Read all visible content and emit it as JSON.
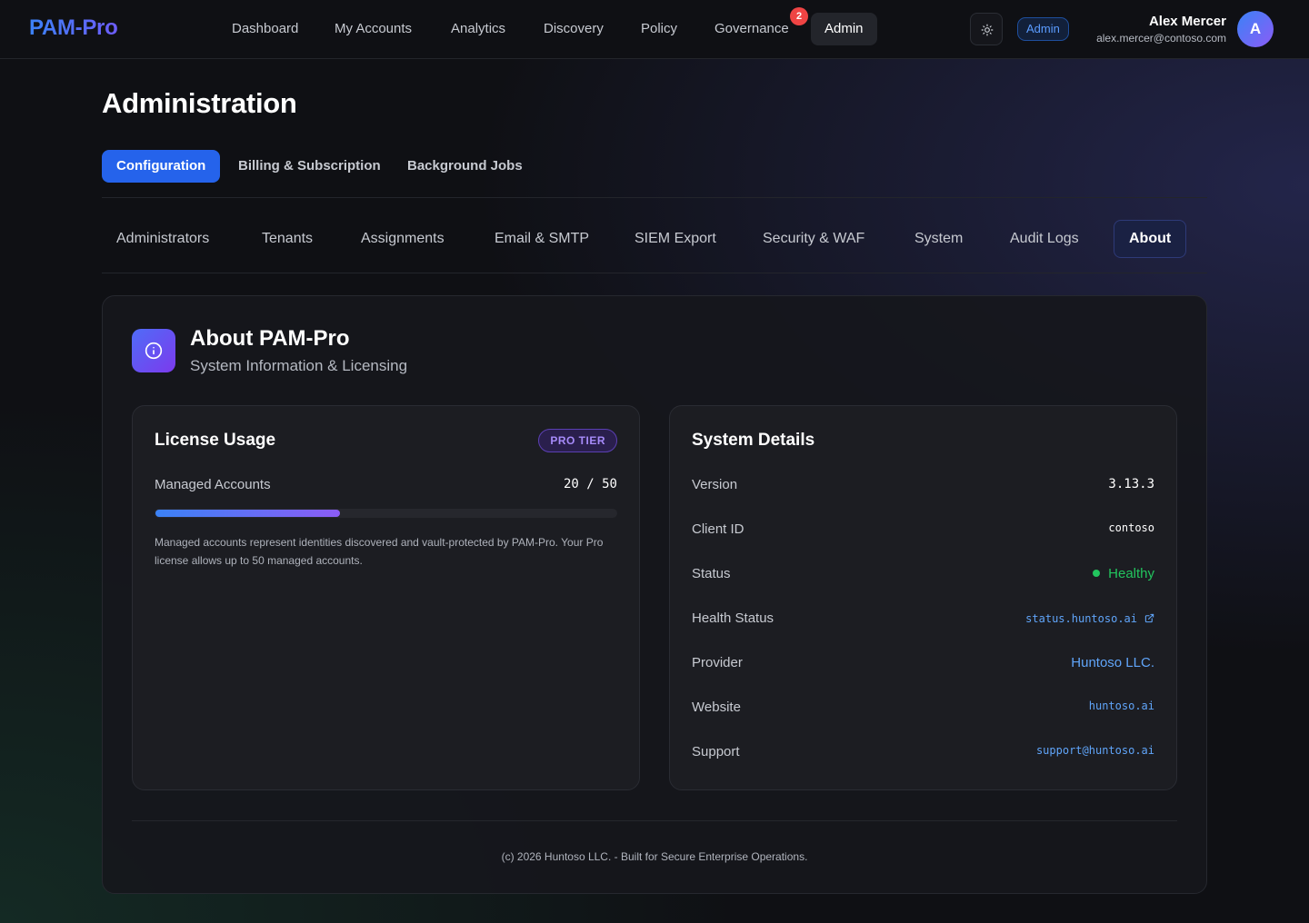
{
  "app": {
    "brand": "PAM-Pro"
  },
  "nav": {
    "items": [
      {
        "label": "Dashboard"
      },
      {
        "label": "My Accounts"
      },
      {
        "label": "Analytics"
      },
      {
        "label": "Discovery"
      },
      {
        "label": "Policy"
      },
      {
        "label": "Governance"
      },
      {
        "label": "Admin"
      }
    ],
    "active": "Admin",
    "governance_badge": "2"
  },
  "header": {
    "theme_icon": "sun-icon",
    "role_badge": "Admin",
    "user": {
      "name": "Alex Mercer",
      "email": "alex.mercer@contoso.com",
      "avatar_initial": "A"
    }
  },
  "page": {
    "title": "Administration"
  },
  "primary_tabs": [
    {
      "label": "Configuration"
    },
    {
      "label": "Billing & Subscription"
    },
    {
      "label": "Background Jobs"
    }
  ],
  "sub_tabs": [
    {
      "label": "Administrators"
    },
    {
      "label": "Tenants"
    },
    {
      "label": "Assignments"
    },
    {
      "label": "Email & SMTP"
    },
    {
      "label": "SIEM Export"
    },
    {
      "label": "Security & WAF"
    },
    {
      "label": "System"
    },
    {
      "label": "Audit Logs"
    },
    {
      "label": "About"
    }
  ],
  "about": {
    "icon": "info-icon",
    "title": "About PAM-Pro",
    "subtitle": "System Information & Licensing",
    "license": {
      "title": "License Usage",
      "tier_badge": "PRO TIER",
      "label": "Managed Accounts",
      "used": 20,
      "limit": 50,
      "count_text": "20 / 50",
      "note": "Managed accounts represent identities discovered and vault-protected by PAM-Pro. Your Pro license allows up to 50 managed accounts."
    },
    "system": {
      "title": "System Details",
      "version_label": "Version",
      "version": "3.13.3",
      "client_id_label": "Client ID",
      "client_id": "contoso",
      "status_label": "Status",
      "status": "Healthy",
      "health_label": "Health Status",
      "health_link": "status.huntoso.ai",
      "provider_label": "Provider",
      "provider": "Huntoso LLC.",
      "website_label": "Website",
      "website": "huntoso.ai",
      "support_label": "Support",
      "support": "support@huntoso.ai"
    },
    "footer": "(c) 2026 Huntoso LLC. - Built for Secure Enterprise Operations."
  },
  "colors": {
    "accent": "#2563eb",
    "brand_gradient_start": "#3b82f6",
    "brand_gradient_end": "#8b5cf6",
    "healthy": "#22c55e",
    "link": "#60a5fa",
    "badge_red": "#ef4444"
  }
}
